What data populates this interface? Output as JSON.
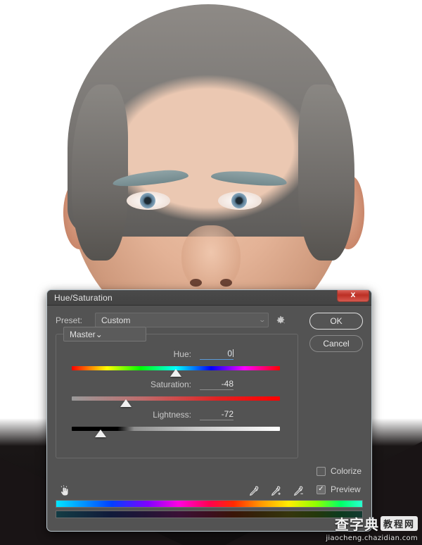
{
  "photo": {
    "description": "man-portrait-grey-hair",
    "alt": "close-up portrait of a man with greyed hair and eyebrows on white background"
  },
  "dialog": {
    "title": "Hue/Saturation",
    "close_label": "x",
    "preset": {
      "label": "Preset:",
      "value": "Custom",
      "caret": "⌄",
      "gear_icon": "gear-icon"
    },
    "buttons": {
      "ok": "OK",
      "cancel": "Cancel"
    },
    "channel": {
      "value": "Master",
      "caret": "⌄"
    },
    "sliders": [
      {
        "label": "Hue:",
        "value": "0",
        "position_percent": 50,
        "active": true,
        "track": "hue-spectrum"
      },
      {
        "label": "Saturation:",
        "value": "-48",
        "position_percent": 26,
        "active": false,
        "track": "saturation-red"
      },
      {
        "label": "Lightness:",
        "value": "-72",
        "position_percent": 14,
        "active": false,
        "track": "lightness-black-white"
      }
    ],
    "checkboxes": [
      {
        "label": "Colorize",
        "checked": false,
        "mark": ""
      },
      {
        "label": "Preview",
        "checked": true,
        "mark": "✓"
      }
    ],
    "tools": {
      "hand": "targeted-adjustment-hand-icon",
      "eyedroppers": [
        {
          "name": "eyedropper-icon",
          "modifier": ""
        },
        {
          "name": "eyedropper-add-icon",
          "modifier": "+"
        },
        {
          "name": "eyedropper-subtract-icon",
          "modifier": "−"
        }
      ]
    },
    "color_bars": {
      "top": "full-spectrum-bright",
      "bottom": "full-spectrum-darkened"
    },
    "colors": {
      "dialog_bg": "#535353",
      "border": "#b9c5cc",
      "close_red": "#bc2f24",
      "active_field_underline": "#5b9ad6",
      "text": "#d7d7d7"
    }
  },
  "watermark": {
    "cn_main": "查字典",
    "cn_badge": "教程网",
    "url": "jiaocheng.chazidian.com"
  }
}
